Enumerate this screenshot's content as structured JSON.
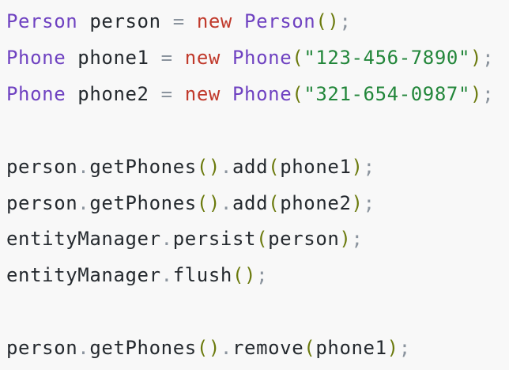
{
  "colors": {
    "background": "#f8f8f8",
    "type": "#6f42c1",
    "keyword": "#c0392b",
    "operator": "#8b949e",
    "string": "#22863a",
    "paren": "#6b7a0d",
    "identifier": "#24292e"
  },
  "lines": [
    [
      {
        "t": "Person",
        "k": "type"
      },
      {
        "t": " person ",
        "k": "identifier"
      },
      {
        "t": "=",
        "k": "operator"
      },
      {
        "t": " ",
        "k": "identifier"
      },
      {
        "t": "new",
        "k": "keyword"
      },
      {
        "t": " ",
        "k": "identifier"
      },
      {
        "t": "Person",
        "k": "type"
      },
      {
        "t": "()",
        "k": "paren"
      },
      {
        "t": ";",
        "k": "operator"
      }
    ],
    [
      {
        "t": "Phone",
        "k": "type"
      },
      {
        "t": " phone1 ",
        "k": "identifier"
      },
      {
        "t": "=",
        "k": "operator"
      },
      {
        "t": " ",
        "k": "identifier"
      },
      {
        "t": "new",
        "k": "keyword"
      },
      {
        "t": " ",
        "k": "identifier"
      },
      {
        "t": "Phone",
        "k": "type"
      },
      {
        "t": "(",
        "k": "paren"
      },
      {
        "t": "\"123-456-7890\"",
        "k": "string"
      },
      {
        "t": ")",
        "k": "paren"
      },
      {
        "t": ";",
        "k": "operator"
      }
    ],
    [
      {
        "t": "Phone",
        "k": "type"
      },
      {
        "t": " phone2 ",
        "k": "identifier"
      },
      {
        "t": "=",
        "k": "operator"
      },
      {
        "t": " ",
        "k": "identifier"
      },
      {
        "t": "new",
        "k": "keyword"
      },
      {
        "t": " ",
        "k": "identifier"
      },
      {
        "t": "Phone",
        "k": "type"
      },
      {
        "t": "(",
        "k": "paren"
      },
      {
        "t": "\"321-654-0987\"",
        "k": "string"
      },
      {
        "t": ")",
        "k": "paren"
      },
      {
        "t": ";",
        "k": "operator"
      }
    ],
    [
      {
        "t": "person",
        "k": "identifier"
      },
      {
        "t": ".",
        "k": "operator"
      },
      {
        "t": "getPhones",
        "k": "identifier"
      },
      {
        "t": "()",
        "k": "paren"
      },
      {
        "t": ".",
        "k": "operator"
      },
      {
        "t": "add",
        "k": "identifier"
      },
      {
        "t": "(",
        "k": "paren"
      },
      {
        "t": "phone1",
        "k": "identifier"
      },
      {
        "t": ")",
        "k": "paren"
      },
      {
        "t": ";",
        "k": "operator"
      }
    ],
    [
      {
        "t": "person",
        "k": "identifier"
      },
      {
        "t": ".",
        "k": "operator"
      },
      {
        "t": "getPhones",
        "k": "identifier"
      },
      {
        "t": "()",
        "k": "paren"
      },
      {
        "t": ".",
        "k": "operator"
      },
      {
        "t": "add",
        "k": "identifier"
      },
      {
        "t": "(",
        "k": "paren"
      },
      {
        "t": "phone2",
        "k": "identifier"
      },
      {
        "t": ")",
        "k": "paren"
      },
      {
        "t": ";",
        "k": "operator"
      }
    ],
    [
      {
        "t": "entityManager",
        "k": "identifier"
      },
      {
        "t": ".",
        "k": "operator"
      },
      {
        "t": "persist",
        "k": "identifier"
      },
      {
        "t": "(",
        "k": "paren"
      },
      {
        "t": "person",
        "k": "identifier"
      },
      {
        "t": ")",
        "k": "paren"
      },
      {
        "t": ";",
        "k": "operator"
      }
    ],
    [
      {
        "t": "entityManager",
        "k": "identifier"
      },
      {
        "t": ".",
        "k": "operator"
      },
      {
        "t": "flush",
        "k": "identifier"
      },
      {
        "t": "()",
        "k": "paren"
      },
      {
        "t": ";",
        "k": "operator"
      }
    ],
    [
      {
        "t": "person",
        "k": "identifier"
      },
      {
        "t": ".",
        "k": "operator"
      },
      {
        "t": "getPhones",
        "k": "identifier"
      },
      {
        "t": "()",
        "k": "paren"
      },
      {
        "t": ".",
        "k": "operator"
      },
      {
        "t": "remove",
        "k": "identifier"
      },
      {
        "t": "(",
        "k": "paren"
      },
      {
        "t": "phone1",
        "k": "identifier"
      },
      {
        "t": ")",
        "k": "paren"
      },
      {
        "t": ";",
        "k": "operator"
      }
    ]
  ]
}
